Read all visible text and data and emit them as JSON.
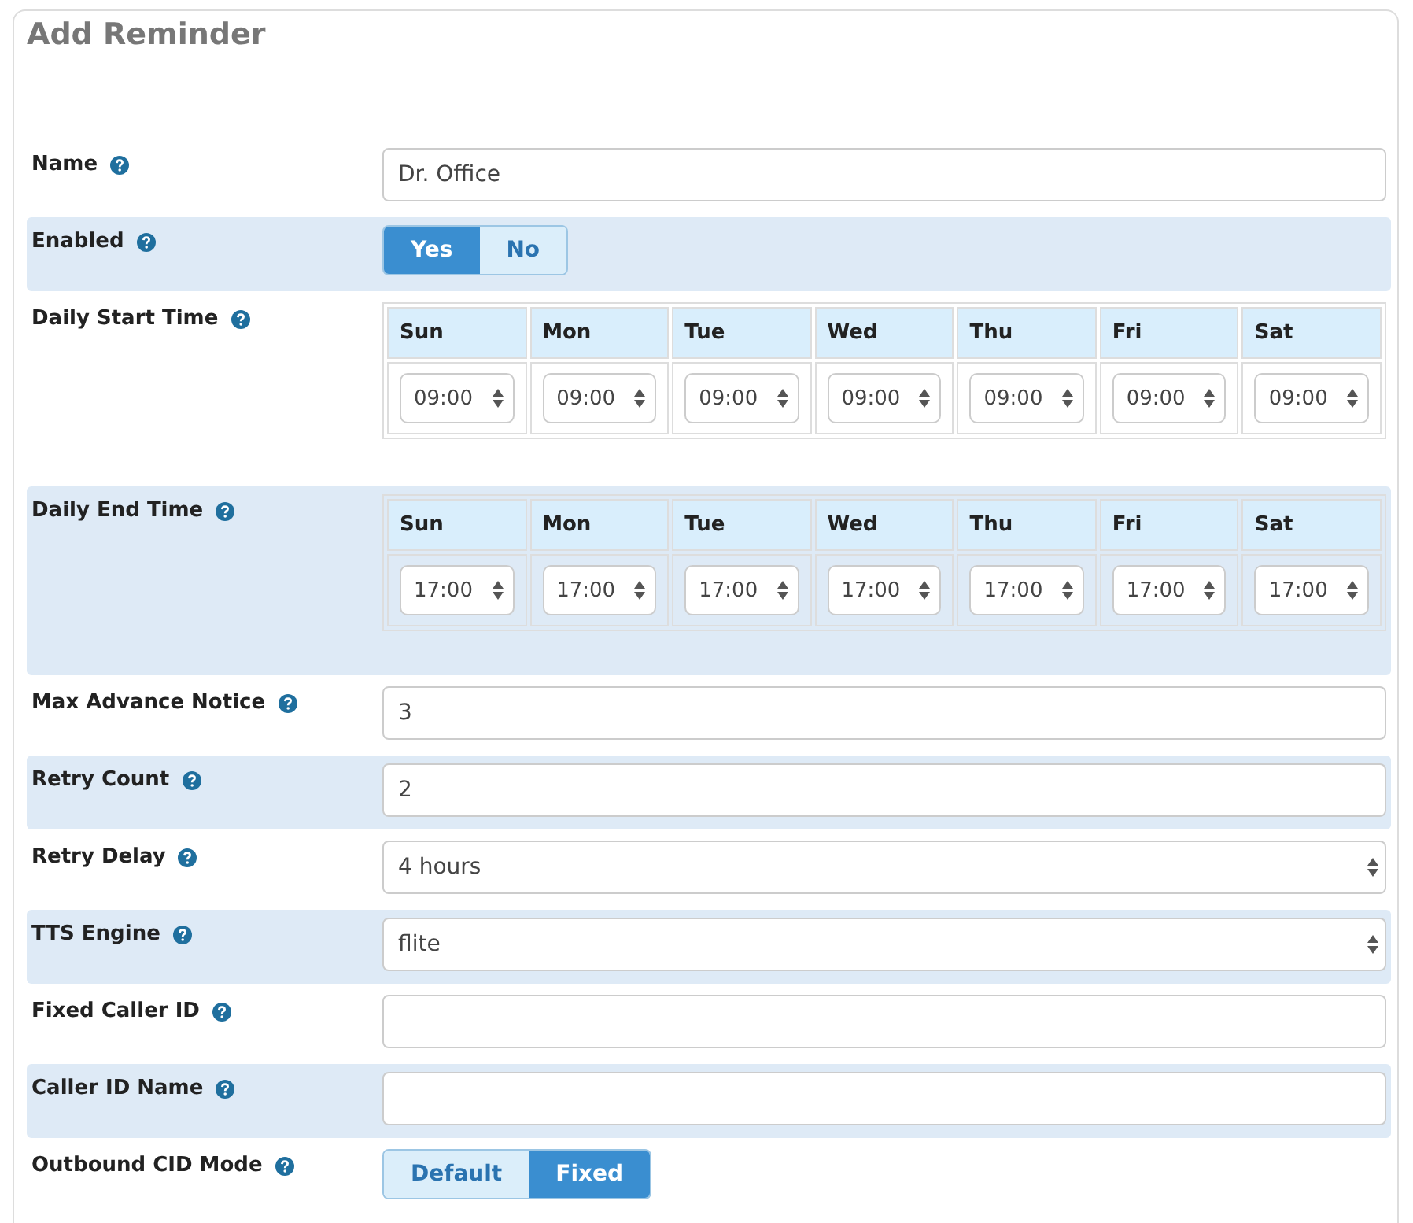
{
  "title": "Add Reminder",
  "rows": [
    {
      "kind": "text",
      "label": "Name",
      "value": "Dr. Office"
    },
    {
      "kind": "toggle",
      "label": "Enabled",
      "options": [
        {
          "label": "Yes",
          "selected": true
        },
        {
          "label": "No",
          "selected": false
        }
      ]
    },
    {
      "kind": "schedule",
      "label": "Daily Start Time",
      "days": [
        {
          "day": "Sun",
          "value": "09:00"
        },
        {
          "day": "Mon",
          "value": "09:00"
        },
        {
          "day": "Tue",
          "value": "09:00"
        },
        {
          "day": "Wed",
          "value": "09:00"
        },
        {
          "day": "Thu",
          "value": "09:00"
        },
        {
          "day": "Fri",
          "value": "09:00"
        },
        {
          "day": "Sat",
          "value": "09:00"
        }
      ]
    },
    {
      "kind": "schedule",
      "label": "Daily End Time",
      "days": [
        {
          "day": "Sun",
          "value": "17:00"
        },
        {
          "day": "Mon",
          "value": "17:00"
        },
        {
          "day": "Tue",
          "value": "17:00"
        },
        {
          "day": "Wed",
          "value": "17:00"
        },
        {
          "day": "Thu",
          "value": "17:00"
        },
        {
          "day": "Fri",
          "value": "17:00"
        },
        {
          "day": "Sat",
          "value": "17:00"
        }
      ]
    },
    {
      "kind": "text",
      "label": "Max Advance Notice",
      "value": "3"
    },
    {
      "kind": "text",
      "label": "Retry Count",
      "value": "2"
    },
    {
      "kind": "select",
      "label": "Retry Delay",
      "value": "4 hours"
    },
    {
      "kind": "select",
      "label": "TTS Engine",
      "value": "flite"
    },
    {
      "kind": "text",
      "label": "Fixed Caller ID"
    },
    {
      "kind": "text",
      "label": "Caller ID Name"
    },
    {
      "kind": "toggle",
      "label": "Outbound CID Mode",
      "options": [
        {
          "label": "Default",
          "selected": false
        },
        {
          "label": "Fixed",
          "selected": true
        }
      ]
    }
  ]
}
